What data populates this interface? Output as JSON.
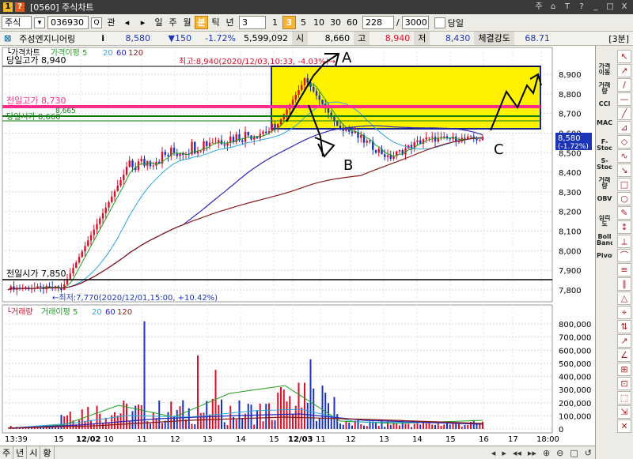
{
  "window": {
    "badge1": "1",
    "badge2": "?",
    "title": "[0560] 주식차트",
    "controls": [
      "주",
      "⌂",
      "T",
      "?",
      "_",
      "□",
      "X"
    ]
  },
  "toolbar": {
    "market": "주식",
    "code": "036930",
    "gwan": "관",
    "periods": [
      "일",
      "주",
      "월",
      "분",
      "틱",
      "년"
    ],
    "active_period": "분",
    "interval_value": "3",
    "intervals": [
      "1",
      "3",
      "5",
      "10",
      "30",
      "60"
    ],
    "active_interval": "3",
    "count_value": "228",
    "total_count": "3000",
    "today_label": "당일"
  },
  "info": {
    "name": "주성엔지니어링",
    "price": "8,580",
    "change": "▼150",
    "change_pct": "-1.72%",
    "volume": "5,599,092",
    "open_label": "시",
    "open": "8,660",
    "high_label": "고",
    "high": "8,940",
    "low_label": "저",
    "low": "8,430",
    "strength_label": "체결강도",
    "strength": "68.71",
    "interval_badge": "[3분]"
  },
  "chart": {
    "legend_price": "가격차트",
    "legend_ma": "가격이평 5",
    "legend_ma_values": [
      "20",
      "60",
      "120"
    ],
    "legend_volume": "거래량",
    "legend_vol_ma": "거래이평 5",
    "legend_vol_ma_values": [
      "20",
      "60",
      "120"
    ],
    "today_high_label": "당일고가 8,940",
    "prev_high_label": "전일고가 8,730",
    "today_open_label": "당일시가 8,660",
    "overlap_label": "8,665",
    "prev_open_label": "전일시가 7,850",
    "max_annotation": "최고:8,940(2020/12/03,10:33, -4.03%)→",
    "min_annotation": "←최저:7,770(2020/12/01,15:00, +10.42%)",
    "current_price_tag": "8,580",
    "current_pct_tag": "(-1.72%)",
    "mark_a": "A",
    "mark_b": "B",
    "mark_c": "C",
    "price_ticks": [
      "8,900",
      "8,800",
      "8,700",
      "8,600",
      "8,500",
      "8,400",
      "8,300",
      "8,200",
      "8,100",
      "8,000",
      "7,900",
      "7,800"
    ],
    "volume_ticks": [
      "800,000",
      "700,000",
      "600,000",
      "500,000",
      "400,000",
      "300,000",
      "200,000",
      "100,000",
      "0"
    ],
    "time_ticks": [
      "13:39",
      "15",
      "12/02",
      "10",
      "11",
      "12",
      "13",
      "14",
      "15",
      "12/03",
      "11",
      "12",
      "13",
      "14",
      "15",
      "16",
      "17",
      "18:00"
    ]
  },
  "right_toolbar": {
    "indicators": [
      "가격이동",
      "거래량",
      "CCI",
      "MACD",
      "F-Stoc",
      "S-Stoc",
      "거래량",
      "OBV",
      "심리도",
      "Boll Band",
      "Pivot"
    ]
  },
  "bottom": {
    "tabs": [
      "주",
      "년",
      "시",
      "황"
    ]
  },
  "colors": {
    "up": "#d8102a",
    "down": "#1b35b9",
    "ma5": "#1e9e1e",
    "ma20": "#2aa6e0",
    "ma60": "#2a2ab8",
    "ma120": "#8b1a1a",
    "highlight": "#fff200",
    "prev_high_line": "#ff2d8e",
    "open_line": "#0f7a0f"
  },
  "chart_data": {
    "type": "candlestick",
    "x": [
      "12/01 13:39",
      "12/01 15:00",
      "12/02 09:00",
      "12/02 10:00",
      "12/02 11:00",
      "12/02 12:00",
      "12/02 13:00",
      "12/02 14:00",
      "12/02 15:00",
      "12/03 09:00",
      "12/03 10:00",
      "12/03 10:33",
      "12/03 11:00",
      "12/03 12:00",
      "12/03 13:00",
      "12/03 14:00",
      "12/03 15:00",
      "12/03 16:00"
    ],
    "close": [
      7810,
      7780,
      7950,
      8350,
      8450,
      8480,
      8600,
      8580,
      8620,
      8620,
      8750,
      8900,
      8640,
      8600,
      8460,
      8540,
      8590,
      8580
    ],
    "volume": [
      12000,
      40000,
      180000,
      150000,
      120000,
      90000,
      110000,
      80000,
      150000,
      200000,
      220000,
      250000,
      130000,
      80000,
      60000,
      50000,
      40000,
      50000
    ],
    "ylim": [
      7750,
      8960
    ],
    "volume_ylim": [
      0,
      850000
    ],
    "high": 8940,
    "low": 7770
  }
}
